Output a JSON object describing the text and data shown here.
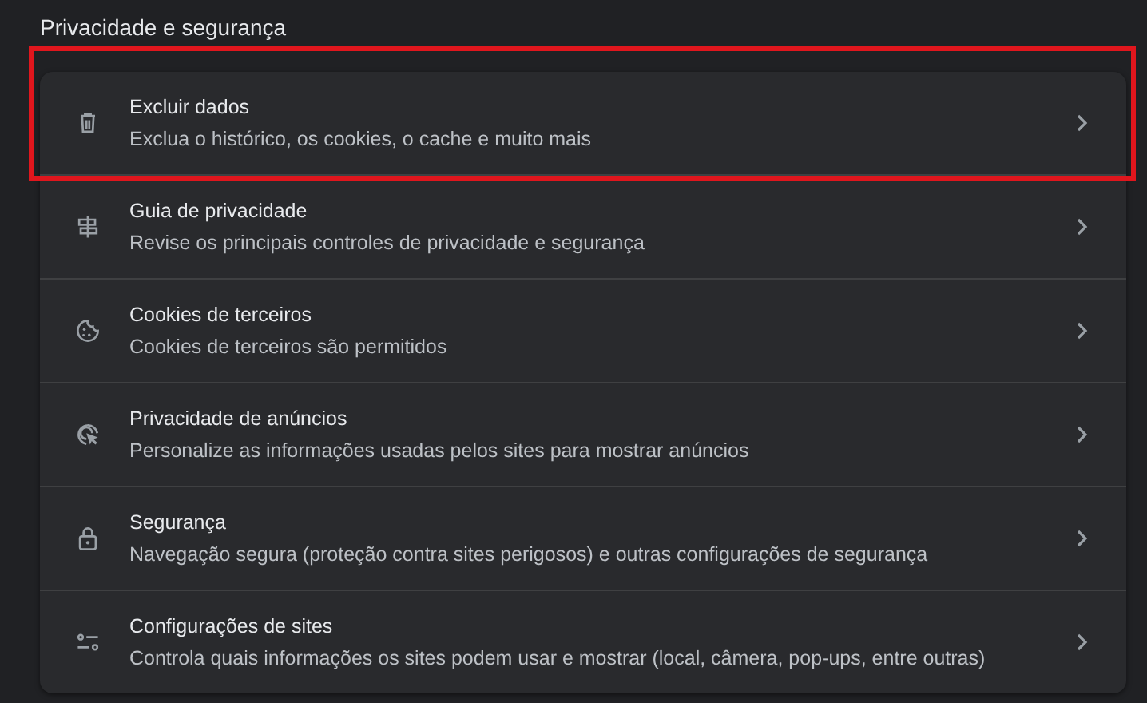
{
  "section_title": "Privacidade e segurança",
  "items": [
    {
      "kind": "trash",
      "title": "Excluir dados",
      "subtitle": "Exclua o histórico, os cookies, o cache e muito mais",
      "highlighted": true
    },
    {
      "kind": "guide",
      "title": "Guia de privacidade",
      "subtitle": "Revise os principais controles de privacidade e segurança",
      "highlighted": false
    },
    {
      "kind": "cookie",
      "title": "Cookies de terceiros",
      "subtitle": "Cookies de terceiros são permitidos",
      "highlighted": false
    },
    {
      "kind": "ads",
      "title": "Privacidade de anúncios",
      "subtitle": "Personalize as informações usadas pelos sites para mostrar anúncios",
      "highlighted": false
    },
    {
      "kind": "lock",
      "title": "Segurança",
      "subtitle": "Navegação segura (proteção contra sites perigosos) e outras configurações de segurança",
      "highlighted": false
    },
    {
      "kind": "tune",
      "title": "Configurações de sites",
      "subtitle": "Controla quais informações os sites podem usar e mostrar (local, câmera, pop-ups, entre outras)",
      "highlighted": false
    }
  ]
}
